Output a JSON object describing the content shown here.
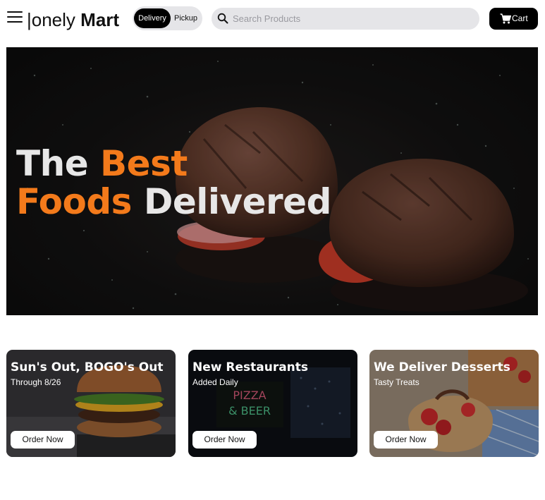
{
  "header": {
    "logo_part1": "|onely",
    "logo_part2": "Mart",
    "toggle": {
      "delivery": "Delivery",
      "pickup": "Pickup",
      "selected": "Delivery"
    },
    "search_placeholder": "Search Products",
    "cart_label": "Cart"
  },
  "hero": {
    "line1_a": "The",
    "line1_b": "Best",
    "line2_a": "Foods",
    "line2_b": "Delivered"
  },
  "cards": [
    {
      "title": "Sun's Out, BOGO's Out",
      "subtitle": "Through 8/26",
      "button": "Order Now"
    },
    {
      "title": "New Restaurants",
      "subtitle": "Added Daily",
      "button": "Order Now",
      "sign_line1": "PIZZA",
      "sign_line2": "& BEER"
    },
    {
      "title": "We Deliver Desserts",
      "subtitle": "Tasty Treats",
      "button": "Order Now"
    }
  ],
  "colors": {
    "accent": "#f37a1b",
    "primary": "#000000",
    "pill_bg": "#e5e5e8"
  }
}
